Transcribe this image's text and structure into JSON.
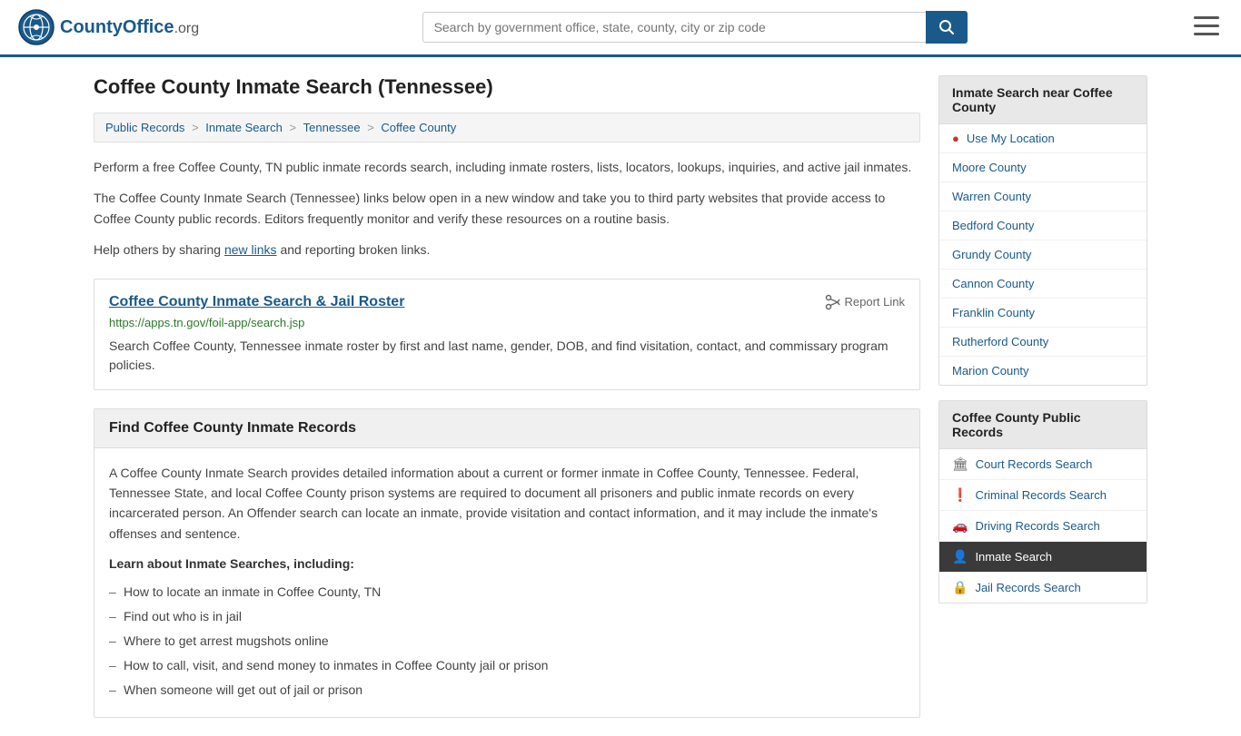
{
  "header": {
    "logo_text": "CountyOffice",
    "logo_suffix": ".org",
    "search_placeholder": "Search by government office, state, county, city or zip code",
    "search_value": ""
  },
  "page": {
    "title": "Coffee County Inmate Search (Tennessee)",
    "breadcrumb": [
      {
        "label": "Public Records",
        "href": "#"
      },
      {
        "label": "Inmate Search",
        "href": "#"
      },
      {
        "label": "Tennessee",
        "href": "#"
      },
      {
        "label": "Coffee County",
        "href": "#"
      }
    ],
    "intro1": "Perform a free Coffee County, TN public inmate records search, including inmate rosters, lists, locators, lookups, inquiries, and active jail inmates.",
    "intro2": "The Coffee County Inmate Search (Tennessee) links below open in a new window and take you to third party websites that provide access to Coffee County public records. Editors frequently monitor and verify these resources on a routine basis.",
    "intro3_prefix": "Help others by sharing ",
    "intro3_link": "new links",
    "intro3_suffix": " and reporting broken links.",
    "link_card": {
      "title": "Coffee County Inmate Search & Jail Roster",
      "report_label": "Report Link",
      "url": "https://apps.tn.gov/foil-app/search.jsp",
      "desc": "Search Coffee County, Tennessee inmate roster by first and last name, gender, DOB, and find visitation, contact, and commissary program policies."
    },
    "find_section": {
      "heading": "Find Coffee County Inmate Records",
      "intro": "A Coffee County Inmate Search provides detailed information about a current or former inmate in Coffee County, Tennessee. Federal, Tennessee State, and local Coffee County prison systems are required to document all prisoners and public inmate records on every incarcerated person. An Offender search can locate an inmate, provide visitation and contact information, and it may include the inmate's offenses and sentence.",
      "learn_heading": "Learn about Inmate Searches, including:",
      "learn_items": [
        "How to locate an inmate in Coffee County, TN",
        "Find out who is in jail",
        "Where to get arrest mugshots online",
        "How to call, visit, and send money to inmates in Coffee County jail or prison",
        "When someone will get out of jail or prison"
      ]
    }
  },
  "sidebar": {
    "nearby_section": {
      "header": "Inmate Search near Coffee County",
      "items": [
        {
          "label": "Use My Location",
          "icon": "location",
          "href": "#"
        },
        {
          "label": "Moore County",
          "icon": "none",
          "href": "#"
        },
        {
          "label": "Warren County",
          "icon": "none",
          "href": "#"
        },
        {
          "label": "Bedford County",
          "icon": "none",
          "href": "#"
        },
        {
          "label": "Grundy County",
          "icon": "none",
          "href": "#"
        },
        {
          "label": "Cannon County",
          "icon": "none",
          "href": "#"
        },
        {
          "label": "Franklin County",
          "icon": "none",
          "href": "#"
        },
        {
          "label": "Rutherford County",
          "icon": "none",
          "href": "#"
        },
        {
          "label": "Marion County",
          "icon": "none",
          "href": "#"
        }
      ]
    },
    "public_records_section": {
      "header": "Coffee County Public Records",
      "items": [
        {
          "label": "Court Records Search",
          "icon": "court",
          "active": false
        },
        {
          "label": "Criminal Records Search",
          "icon": "exclamation",
          "active": false
        },
        {
          "label": "Driving Records Search",
          "icon": "car",
          "active": false
        },
        {
          "label": "Inmate Search",
          "icon": "person",
          "active": true
        },
        {
          "label": "Jail Records Search",
          "icon": "lock",
          "active": false
        }
      ]
    }
  }
}
